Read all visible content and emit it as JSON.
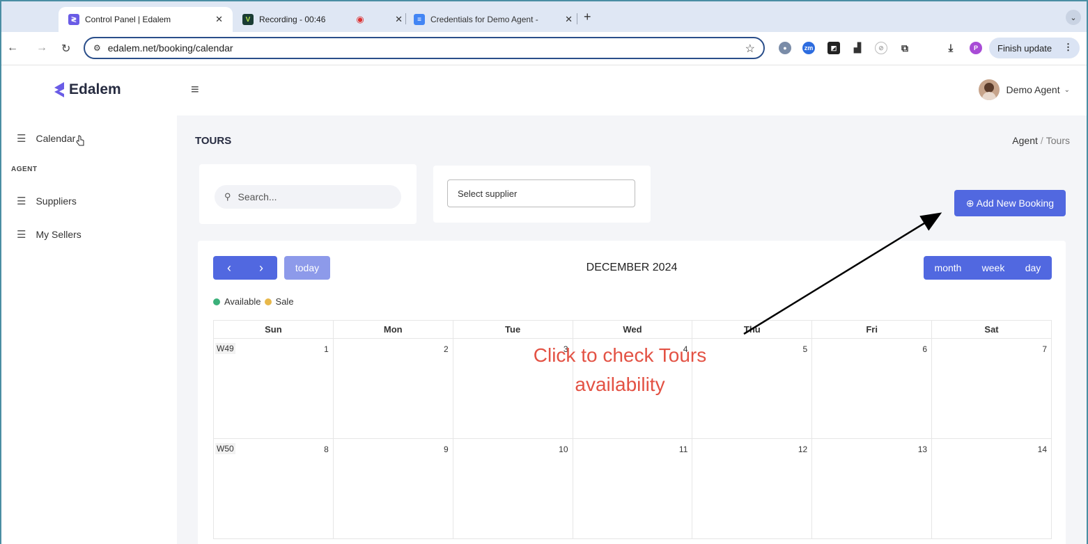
{
  "browser": {
    "tabs": [
      {
        "title": "Control Panel | Edalem",
        "favicon_color": "#6a5ce6",
        "active": true
      },
      {
        "title": "Recording - 00:46",
        "favicon_color": "#1a3c34",
        "active": false
      },
      {
        "title": "Credentials for Demo Agent -",
        "favicon_color": "#4285f4",
        "active": false
      }
    ],
    "url": "edalem.net/booking/calendar",
    "finish_update": "Finish update",
    "ext_zm": "zm",
    "ext_p": "P"
  },
  "app": {
    "logo": "Edalem",
    "user_name": "Demo Agent",
    "sidebar": {
      "calendar": "Calendar",
      "section": "AGENT",
      "suppliers": "Suppliers",
      "sellers": "My Sellers"
    },
    "page_title": "TOURS",
    "breadcrumb": {
      "root": "Agent",
      "sep": "/",
      "current": "Tours"
    },
    "search_placeholder": "Search...",
    "supplier_placeholder": "Select supplier",
    "add_button": "⊕ Add New Booking",
    "calendar": {
      "prev": "‹",
      "next": "›",
      "today": "today",
      "title": "DECEMBER 2024",
      "views": [
        "month",
        "week",
        "day"
      ],
      "legend": [
        {
          "label": "Available",
          "color": "#3bb07a"
        },
        {
          "label": "Sale",
          "color": "#e8b84a"
        }
      ],
      "weekdays": [
        "Sun",
        "Mon",
        "Tue",
        "Wed",
        "Thu",
        "Fri",
        "Sat"
      ],
      "weeks": [
        {
          "label": "W49",
          "days": [
            "1",
            "2",
            "3",
            "4",
            "5",
            "6",
            "7"
          ]
        },
        {
          "label": "W50",
          "days": [
            "8",
            "9",
            "10",
            "11",
            "12",
            "13",
            "14"
          ]
        }
      ]
    }
  },
  "annotation": {
    "line1": "Click to check Tours",
    "line2": "availability",
    "color": "#e35244"
  },
  "colors": {
    "accent": "#5168e0",
    "accent_light": "#8d9aea"
  }
}
